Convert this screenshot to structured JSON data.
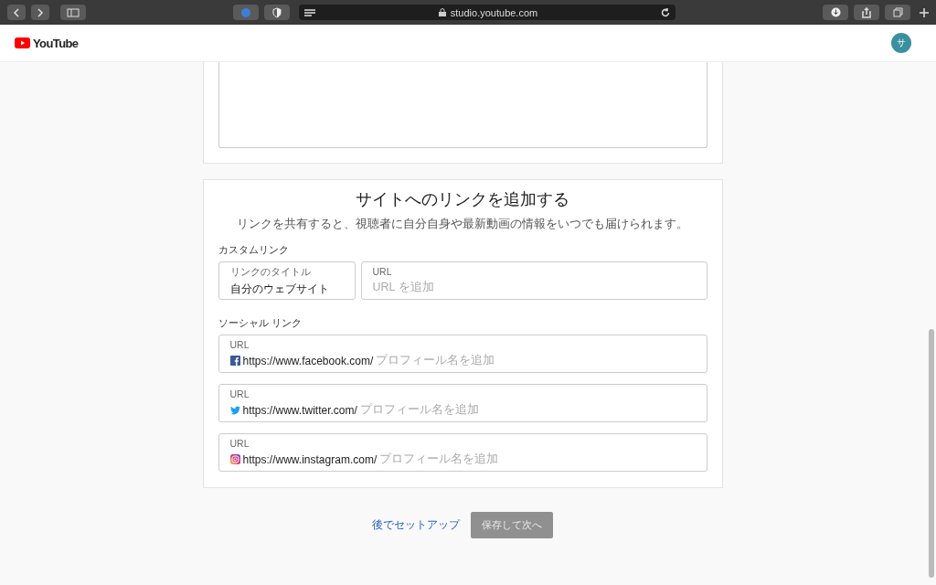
{
  "browser": {
    "address": "studio.youtube.com"
  },
  "header": {
    "logo": "YouTube",
    "avatar": "サ"
  },
  "links_card": {
    "title": "サイトへのリンクを追加する",
    "subtitle": "リンクを共有すると、視聴者に自分自身や最新動画の情報をいつでも届けられます。",
    "custom_heading": "カスタムリンク",
    "custom_fields": [
      {
        "label": "リンクのタイトル",
        "value": "自分のウェブサイト"
      },
      {
        "label": "URL",
        "placeholder": "URL を追加"
      }
    ],
    "social_heading": "ソーシャル リンク",
    "social_links": [
      {
        "kind": "facebook",
        "label": "URL",
        "prefix": "https://www.facebook.com/",
        "placeholder": "プロフィール名を追加"
      },
      {
        "kind": "twitter",
        "label": "URL",
        "prefix": "https://www.twitter.com/",
        "placeholder": "プロフィール名を追加"
      },
      {
        "kind": "instagram",
        "label": "URL",
        "prefix": "https://www.instagram.com/",
        "placeholder": "プロフィール名を追加"
      }
    ]
  },
  "footer": {
    "skip_link": "後でセットアップ",
    "next_button": {
      "label": "保存して次へ",
      "disabled": true
    }
  }
}
